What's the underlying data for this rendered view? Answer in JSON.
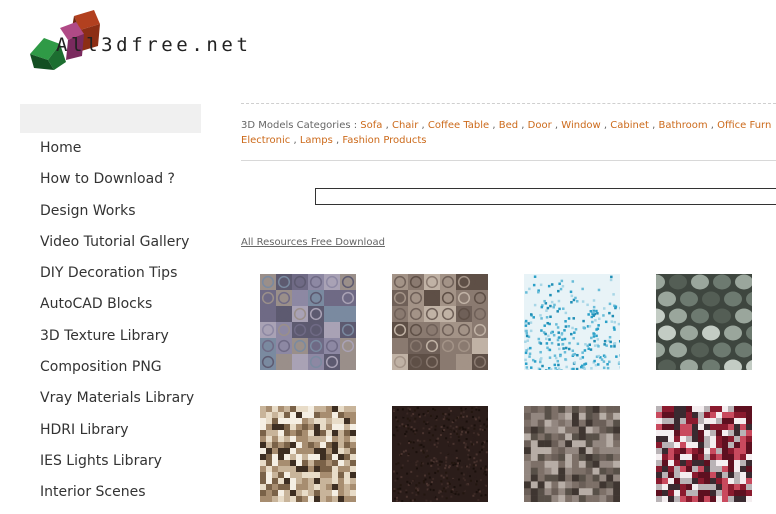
{
  "site": {
    "logo_text": "All3dfree.net"
  },
  "sidebar": {
    "items": [
      {
        "label": "Home"
      },
      {
        "label": "How to Download ?"
      },
      {
        "label": "Design Works"
      },
      {
        "label": "Video Tutorial Gallery"
      },
      {
        "label": "DIY Decoration Tips"
      },
      {
        "label": "AutoCAD Blocks"
      },
      {
        "label": "3D Texture Library"
      },
      {
        "label": "Composition PNG"
      },
      {
        "label": "Vray Materials Library"
      },
      {
        "label": "HDRI Library"
      },
      {
        "label": "IES Lights Library"
      },
      {
        "label": "Interior Scenes"
      }
    ]
  },
  "categories": {
    "label": "3D Models Categories :",
    "separator": ",",
    "line1": [
      "Sofa",
      "Chair",
      "Coffee Table",
      "Bed",
      "Door",
      "Window",
      "Cabinet",
      "Bathroom",
      "Office Furn"
    ],
    "line2": [
      "Electronic",
      "Lamps",
      "Fashion Products"
    ]
  },
  "search": {
    "value": "",
    "placeholder": ""
  },
  "resources_link": "All Resources Free Download",
  "textures": [
    {
      "name": "mosaic-swirl-tiles-texture",
      "palette": [
        "#6f6a85",
        "#8d88a3",
        "#a9a2b5",
        "#7a8aa0",
        "#9a8f8a",
        "#5d5a70"
      ]
    },
    {
      "name": "rose-carved-stone-texture",
      "palette": [
        "#8a7a70",
        "#5e4f46",
        "#a39387",
        "#6f6058",
        "#c0b2a5"
      ]
    },
    {
      "name": "blue-dotted-gradient-texture",
      "palette": [
        "#2aa0c8",
        "#68bcd8",
        "#1f8eb5",
        "#a7d6e6",
        "#e8f3f7"
      ]
    },
    {
      "name": "arabesque-tile-texture",
      "palette": [
        "#6d7a70",
        "#9aa69c",
        "#3e463f",
        "#c3ccc4",
        "#545e55"
      ]
    },
    {
      "name": "beige-brown-pixel-mosaic-texture",
      "palette": [
        "#f5efe4",
        "#c8b49a",
        "#7a6248",
        "#e8dcc8",
        "#3d2e22",
        "#a78d70"
      ]
    },
    {
      "name": "dark-brown-noise-texture",
      "palette": [
        "#2b1d1a",
        "#3a2824",
        "#22160f",
        "#4a342f",
        "#1a100c"
      ]
    },
    {
      "name": "grey-brown-mosaic-texture",
      "palette": [
        "#6b5f58",
        "#938780",
        "#3f3631",
        "#b7ada6",
        "#585048",
        "#7d7068"
      ]
    },
    {
      "name": "red-grey-pixel-mosaic-texture",
      "palette": [
        "#8a1a2e",
        "#c94a5e",
        "#f4eef0",
        "#3a2a30",
        "#b9b3b6",
        "#5e1020"
      ]
    }
  ]
}
